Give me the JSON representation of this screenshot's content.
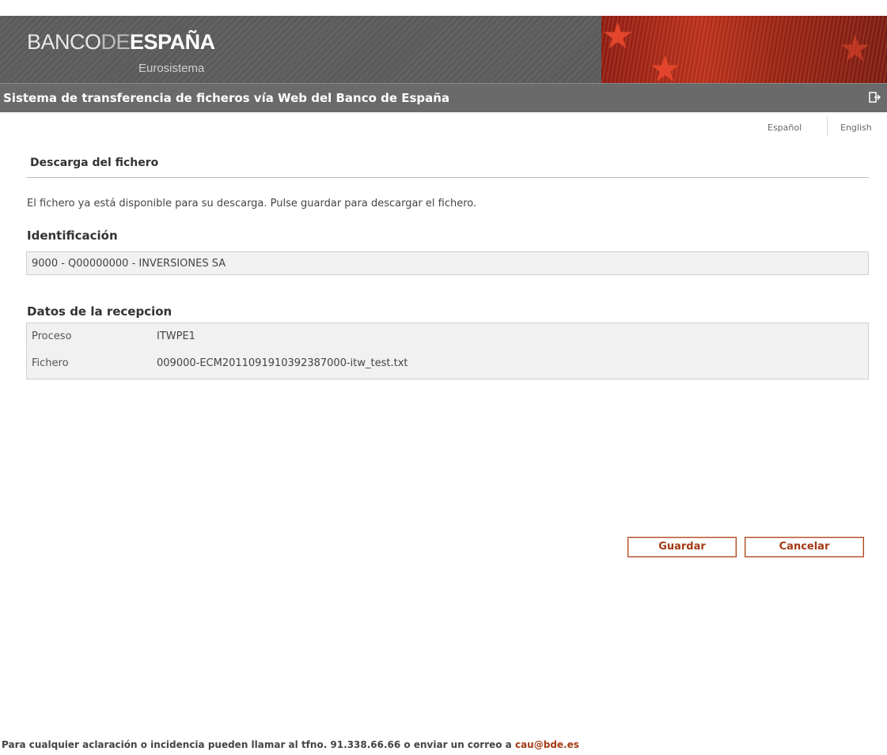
{
  "header": {
    "logo_banco": "BANCO",
    "logo_de": "DE",
    "logo_espana": "ESPAÑA",
    "logo_sub": "Eurosistema",
    "app_title": "Sistema de transferencia de ficheros vía Web del Banco de España"
  },
  "languages": {
    "spanish": "Español",
    "english": "English"
  },
  "page": {
    "section_title": "Descarga del fichero",
    "info_text": "El fichero ya está disponible para su descarga. Pulse guardar para descargar el fichero."
  },
  "identificacion": {
    "heading": "Identificación",
    "value": "9000 - Q00000000 - INVERSIONES SA"
  },
  "recepcion": {
    "heading": "Datos de la recepcion",
    "rows": [
      {
        "label": "Proceso",
        "value": "ITWPE1"
      },
      {
        "label": "Fichero",
        "value": "009000-ECM2011091910392387000-itw_test.txt"
      }
    ]
  },
  "buttons": {
    "guardar": "Guardar",
    "cancelar": "Cancelar"
  },
  "footer": {
    "text": "Para cualquier aclaración o incidencia pueden llamar al tfno. 91.338.66.66 o enviar un correo a ",
    "email": "cau@bde.es"
  },
  "colors": {
    "accent": "#a23a15",
    "banner_gray": "#5b5b5b",
    "banner_red": "#b7301c"
  }
}
